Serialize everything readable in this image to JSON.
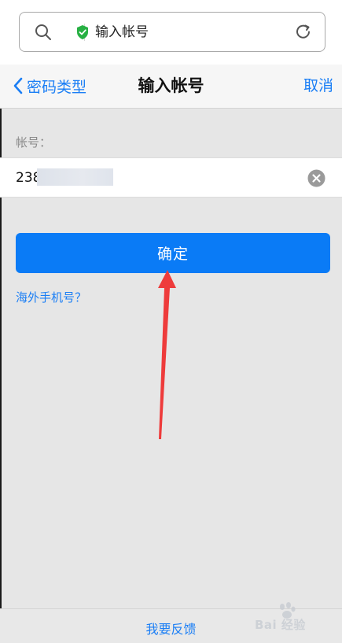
{
  "browser": {
    "address_text": "输入帐号"
  },
  "nav": {
    "back_label": "密码类型",
    "title": "输入帐号",
    "cancel_label": "取消"
  },
  "form": {
    "account_label": "帐号：",
    "account_value": "238",
    "confirm_label": "确定",
    "overseas_link": "海外手机号？"
  },
  "footer": {
    "feedback_label": "我要反馈"
  },
  "watermark": {
    "text": "Bai 经验"
  },
  "colors": {
    "accent": "#1a7ef5",
    "button": "#0a7bf6",
    "secure_green": "#27b043",
    "annotation_red": "#ee3b3b"
  }
}
